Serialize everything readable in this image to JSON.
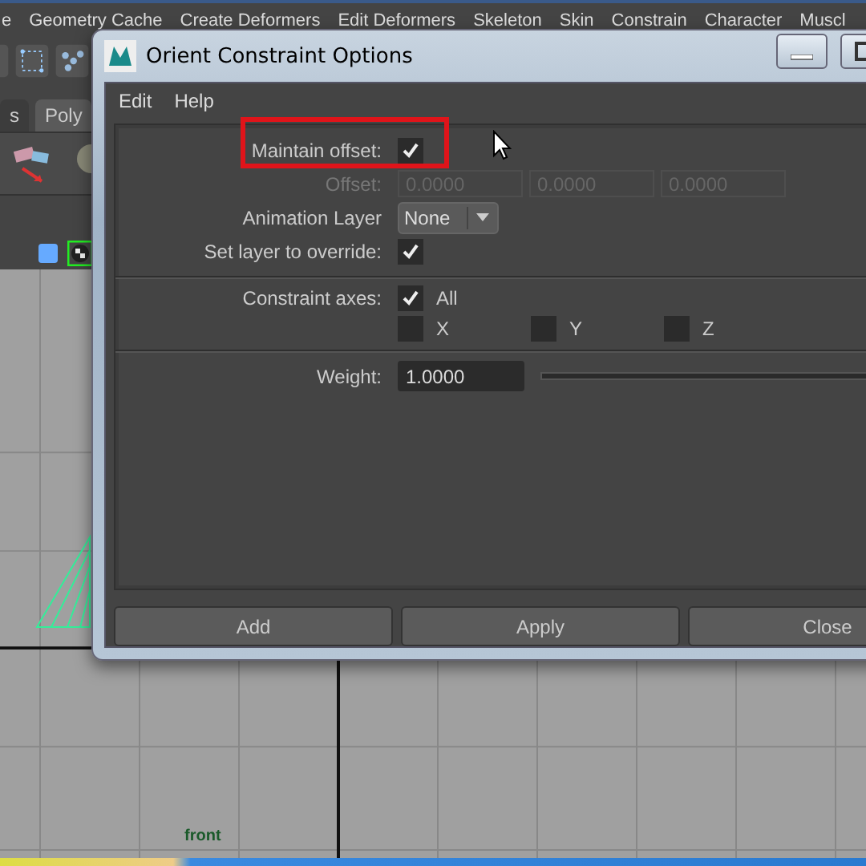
{
  "app_menu": [
    "e",
    "Geometry Cache",
    "Create Deformers",
    "Edit Deformers",
    "Skeleton",
    "Skin",
    "Constrain",
    "Character",
    "Muscl"
  ],
  "shelf_tabs": [
    {
      "label": "s",
      "selected": false
    },
    {
      "label": "Poly",
      "selected": true
    }
  ],
  "viewport": {
    "label": "front"
  },
  "dialog": {
    "title": "Orient Constraint Options",
    "menu": [
      "Edit",
      "Help"
    ],
    "maintain_offset": {
      "label": "Maintain offset:",
      "checked": true,
      "highlighted": true
    },
    "offset": {
      "label": "Offset:",
      "disabled": true,
      "values": [
        "0.0000",
        "0.0000",
        "0.0000"
      ]
    },
    "animation_layer": {
      "label": "Animation Layer",
      "value": "None"
    },
    "override": {
      "label": "Set layer to override:",
      "checked": true
    },
    "axes": {
      "label": "Constraint axes:",
      "options": [
        {
          "label": "All",
          "checked": true
        },
        {
          "label": "X",
          "checked": false
        },
        {
          "label": "Y",
          "checked": false
        },
        {
          "label": "Z",
          "checked": false
        }
      ]
    },
    "weight": {
      "label": "Weight:",
      "value": "1.0000"
    },
    "buttons": [
      "Add",
      "Apply",
      "Close"
    ]
  }
}
